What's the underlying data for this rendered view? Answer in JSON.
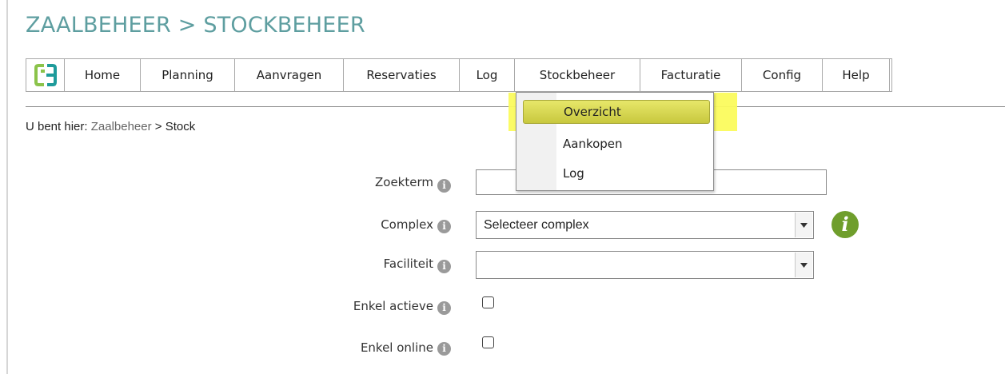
{
  "page": {
    "title": "ZAALBEHEER > STOCKBEHEER"
  },
  "nav": {
    "items": [
      {
        "label": "Home"
      },
      {
        "label": "Planning"
      },
      {
        "label": "Aanvragen"
      },
      {
        "label": "Reservaties"
      },
      {
        "label": "Log"
      },
      {
        "label": "Stockbeheer"
      },
      {
        "label": "Facturatie"
      },
      {
        "label": "Config"
      },
      {
        "label": "Help"
      }
    ],
    "active": "Stockbeheer",
    "logo_colors": {
      "green": "#8bc34a",
      "teal": "#1e9b9b"
    }
  },
  "dropdown": {
    "items": [
      {
        "label": "Overzicht",
        "selected": true
      },
      {
        "label": "Aankopen",
        "selected": false
      },
      {
        "label": "Log",
        "selected": false
      }
    ],
    "highlight_color": "#fbfb5d"
  },
  "breadcrumb": {
    "prefix": "U bent hier:",
    "link": "Zaalbeheer",
    "separator": ">",
    "current": "Stock"
  },
  "form": {
    "zoekterm": {
      "label": "Zoekterm",
      "value": ""
    },
    "complex": {
      "label": "Complex",
      "value": "Selecteer complex"
    },
    "faciliteit": {
      "label": "Faciliteit",
      "value": ""
    },
    "enkel_actieve": {
      "label": "Enkel actieve",
      "checked": false
    },
    "enkel_online": {
      "label": "Enkel online",
      "checked": false
    },
    "info_glyph": "i"
  },
  "colors": {
    "title": "#5e9ea0",
    "info_green": "#6f9e2c"
  }
}
